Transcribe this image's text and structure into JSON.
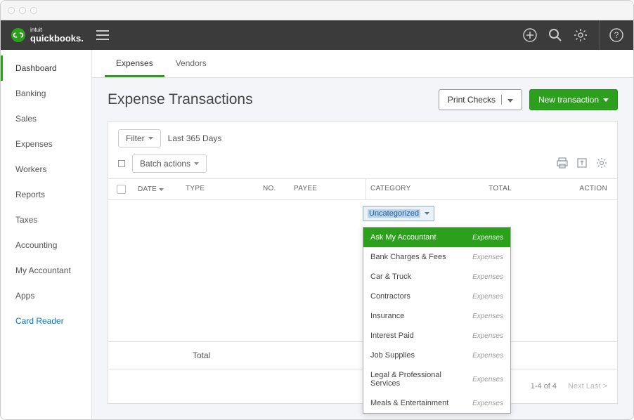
{
  "brand": {
    "intuit": "intuit",
    "name": "quickbooks."
  },
  "sidebar": {
    "items": [
      {
        "label": "Dashboard"
      },
      {
        "label": "Banking"
      },
      {
        "label": "Sales"
      },
      {
        "label": "Expenses"
      },
      {
        "label": "Workers"
      },
      {
        "label": "Reports"
      },
      {
        "label": "Taxes"
      },
      {
        "label": "Accounting"
      },
      {
        "label": "My Accountant"
      },
      {
        "label": "Apps"
      },
      {
        "label": "Card Reader"
      }
    ]
  },
  "subtabs": {
    "expenses": "Expenses",
    "vendors": "Vendors"
  },
  "page": {
    "title": "Expense Transactions"
  },
  "header_actions": {
    "print_checks": "Print Checks",
    "new_transaction": "New transaction"
  },
  "filters": {
    "filter_label": "Filter",
    "range": "Last 365 Days",
    "batch": "Batch actions"
  },
  "columns": {
    "date": "DATE",
    "type": "TYPE",
    "no": "NO.",
    "payee": "PAYEE",
    "category": "CATEGORY",
    "total": "TOTAL",
    "action": "ACTION"
  },
  "category_field": {
    "selected": "Uncategorized"
  },
  "category_options": [
    {
      "name": "Ask My Accountant",
      "type": "Expenses"
    },
    {
      "name": "Bank Charges & Fees",
      "type": "Expenses"
    },
    {
      "name": "Car & Truck",
      "type": "Expenses"
    },
    {
      "name": "Contractors",
      "type": "Expenses"
    },
    {
      "name": "Insurance",
      "type": "Expenses"
    },
    {
      "name": "Interest Paid",
      "type": "Expenses"
    },
    {
      "name": "Job Supplies",
      "type": "Expenses"
    },
    {
      "name": "Legal & Professional Services",
      "type": "Expenses"
    },
    {
      "name": "Meals & Entertainment",
      "type": "Expenses"
    }
  ],
  "totals": {
    "label": "Total"
  },
  "pagination": {
    "range": "1-4 of 4",
    "next": "Next Last >"
  }
}
